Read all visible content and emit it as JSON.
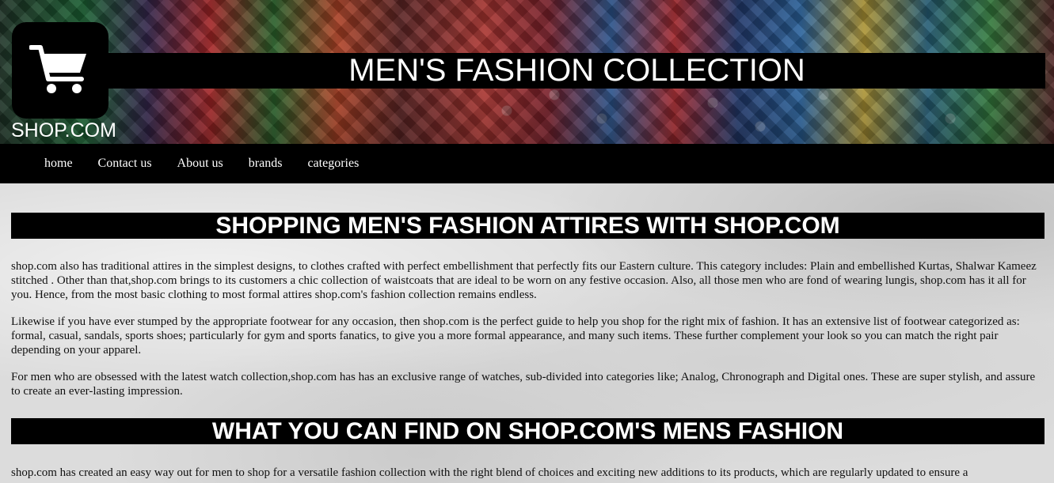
{
  "header": {
    "site_title": "MEN'S FASHION COLLECTION",
    "logo_text": "SHOP.COM",
    "logo_icon": "shopping-cart-icon"
  },
  "nav": {
    "items": [
      {
        "label": "home"
      },
      {
        "label": "Contact us"
      },
      {
        "label": "About us"
      },
      {
        "label": "brands"
      },
      {
        "label": "categories"
      }
    ]
  },
  "main": {
    "heading1": "SHOPPING MEN'S FASHION ATTIRES WITH SHOP.COM",
    "paragraphs": [
      "shop.com also has traditional attires in the simplest designs, to clothes crafted with perfect embellishment that perfectly fits our Eastern culture. This category includes: Plain and embellished Kurtas, Shalwar Kameez stitched . Other than that,shop.com brings to its customers a chic collection of waistcoats that are ideal to be worn on any festive occasion. Also, all those men who are fond of wearing lungis, shop.com has it all for you. Hence, from the most basic clothing to most formal attires shop.com's fashion collection remains endless.",
      "Likewise if you have ever stumped by the appropriate footwear for any occasion, then shop.com is the perfect guide to help you shop for the right mix of fashion. It has an extensive list of footwear categorized as: formal, casual, sandals, sports shoes; particularly for gym and sports fanatics, to give you a more formal appearance, and many such items. These further complement your look so you can match the right pair depending on your apparel.",
      "For men who are obsessed with the latest watch collection,shop.com has has an exclusive range of watches, sub-divided into categories like; Analog, Chronograph and Digital ones. These are super stylish, and assure to create an ever-lasting impression."
    ],
    "heading2": "WHAT YOU CAN FIND ON SHOP.COM'S MENS FASHION",
    "paragraph4": "shop.com has created an easy way out for men to shop for a versatile fashion collection with the right blend of choices and exciting new additions to its products, which are regularly updated to ensure a"
  },
  "colors": {
    "bar_background": "#000000",
    "bar_text": "#ffffff"
  }
}
